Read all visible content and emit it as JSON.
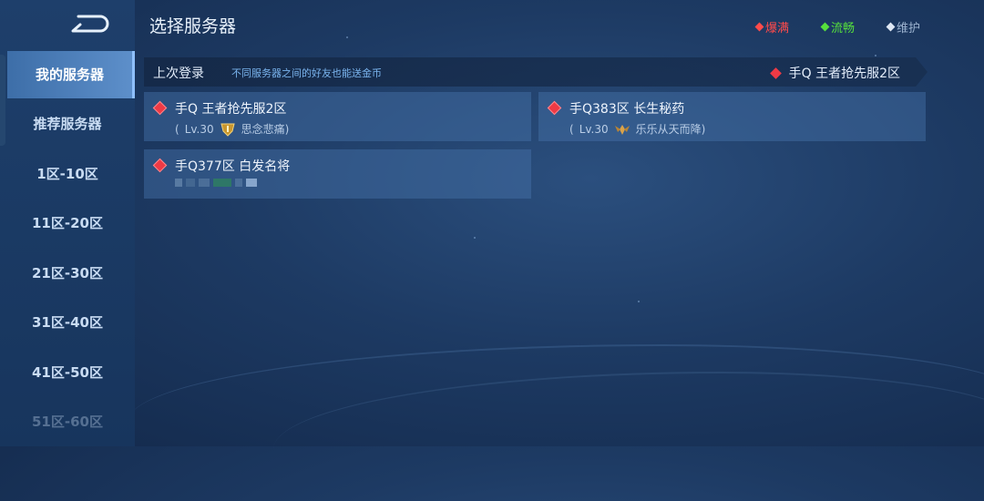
{
  "header": {
    "title": "选择服务器",
    "legend": [
      {
        "label": "爆满",
        "color": "#ff4b4b"
      },
      {
        "label": "流畅",
        "color": "#56e03c"
      },
      {
        "label": "维护",
        "color": "#9db4d0"
      }
    ]
  },
  "sidebar": {
    "items": [
      {
        "label": "我的服务器",
        "active": true
      },
      {
        "label": "推荐服务器"
      },
      {
        "label": "1区-10区"
      },
      {
        "label": "11区-20区"
      },
      {
        "label": "21区-30区"
      },
      {
        "label": "31区-40区"
      },
      {
        "label": "41区-50区"
      },
      {
        "label": "51区-60区"
      }
    ]
  },
  "last_login": {
    "label": "上次登录",
    "note": "不同服务器之间的好友也能送金币",
    "server": "手Q 王者抢先服2区"
  },
  "servers": [
    {
      "name": "手Q 王者抢先服2区",
      "sub_open": "(",
      "level": "Lv.30",
      "character": "思念悲痛)",
      "rank_icon": "shield-rank-icon"
    },
    {
      "name": "手Q383区 长生秘药",
      "sub_open": "(",
      "level": "Lv.30",
      "character": "乐乐从天而降)",
      "rank_icon": "wings-rank-icon"
    },
    {
      "name": "手Q377区 白发名将"
    }
  ]
}
